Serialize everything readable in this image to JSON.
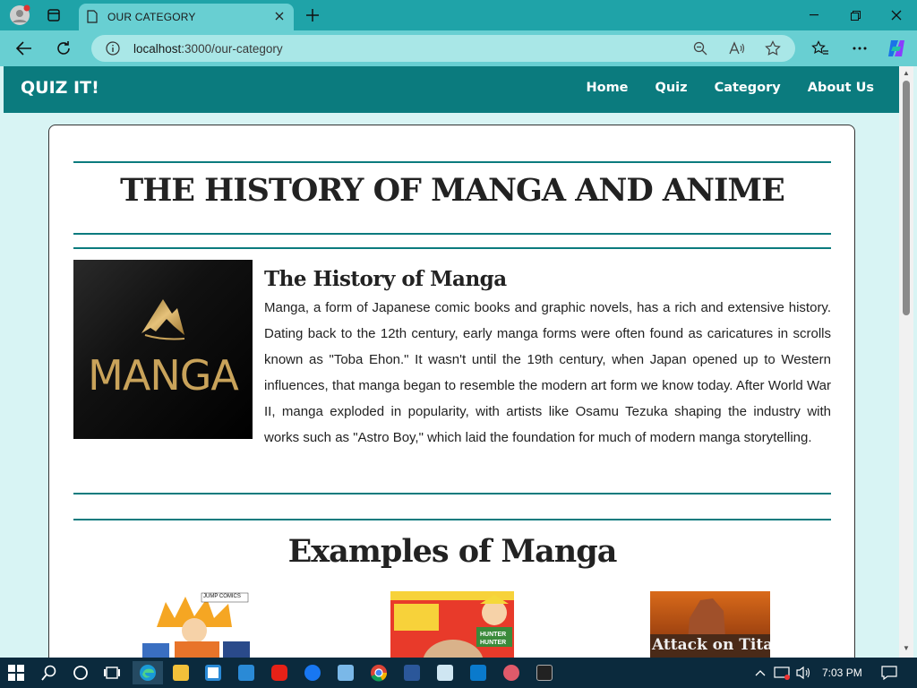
{
  "browser": {
    "tab_title": "OUR CATEGORY",
    "url_host": "localhost",
    "url_path": ":3000/our-category"
  },
  "site": {
    "brand": "QUIZ IT!",
    "nav": [
      "Home",
      "Quiz",
      "Category",
      "About Us"
    ]
  },
  "content": {
    "main_title": "THE HISTORY OF MANGA AND ANIME",
    "manga_logo_text": "MANGA",
    "history_title": "The History of Manga",
    "history_text": "Manga, a form of Japanese comic books and graphic novels, has a rich and extensive history. Dating back to the 12th century, early manga forms were often found as caricatures in scrolls known as \"Toba Ehon.\" It wasn't until the 19th century, when Japan opened up to Western influences, that manga began to resemble the modern art form we know today. After World War II, manga exploded in popularity, with artists like Osamu Tezuka shaping the industry with works such as \"Astro Boy,\" which laid the foundation for much of modern manga storytelling.",
    "examples_title": "Examples of Manga",
    "covers": [
      {
        "name": "naruto-cover",
        "text": "JUMP COMICS"
      },
      {
        "name": "hunter-x-hunter-cover",
        "text": "HUNTER HUNTER"
      },
      {
        "name": "attack-on-titan-cover",
        "text": "Attack on Titan"
      }
    ]
  },
  "taskbar": {
    "time": "7:03 PM"
  },
  "colors": {
    "navbar": "#0b7b7e",
    "accent_rule": "#0b7b7e",
    "browser_tabbar": "#1fa3a8",
    "browser_toolbar": "#68cfd2",
    "page_bg": "#d8f4f4",
    "taskbar": "#0b2a3d"
  }
}
